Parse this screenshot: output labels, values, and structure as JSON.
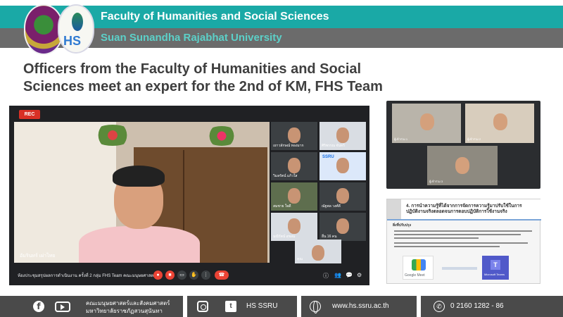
{
  "header": {
    "faculty": "Faculty of Humanities and Social Sciences",
    "university": "Suan Sunandha Rajabhat University",
    "logo_text": "HS"
  },
  "article": {
    "title_line1": "Officers from the Faculty of Humanities and Social",
    "title_line2": "Sciences meet an expert for the 2nd of KM, FHS Team"
  },
  "meeting": {
    "rec_label": "REC",
    "main_speaker": "อัมรินทร์ เผ่าไทย",
    "meeting_name": "ห้องประชุมสรุปผลการดำเนินงาน ครั้งที่ 2 กลุ่ม FHS Team คณะมนุษยศาสตร์...",
    "tiles": [
      {
        "name": "เยาวลักษณ์ ทองมาก"
      },
      {
        "name": "ศิริพรรณ จันทร์"
      },
      {
        "name": "วิมลรัตน์ แก้วใส"
      },
      {
        "name": "SSRU"
      },
      {
        "name": "สมชาย ใจดี"
      },
      {
        "name": "ณัฐพล วงศ์ดี"
      },
      {
        "name": "มณีรัตน์ สุขสม"
      },
      {
        "name": "อื่น 16 คน"
      },
      {
        "name": "คุณ"
      }
    ],
    "end_call_icon": "phone-end-icon"
  },
  "side_meeting": {
    "tiles": [
      {
        "name": "ผู้เข้าร่วม 1"
      },
      {
        "name": "ผู้เข้าร่วม 2"
      },
      {
        "name": "ผู้เข้าร่วม 3"
      }
    ]
  },
  "slide": {
    "heading": "4. การนำความรู้ที่ได้จากการจัดการความรู้มาปรับใช้ในการปฏิบัติงานจริงตลอดจนการตอบปฏิบัติการใช้งานจริง",
    "subheading": "สิ่งที่ปรับปรุง",
    "google_meet_label": "Google Meet",
    "teams_label": "Microsoft Teams",
    "teams_letter": "T"
  },
  "footer": {
    "org_line1": "คณะมนุษยศาสตร์และสังคมศาสตร์",
    "org_line2": "มหาวิทยาลัยราชภัฏสวนสุนันทา",
    "social_handle": "HS SSRU",
    "website": "www.hs.ssru.ac.th",
    "phone": "0 2160 1282 - 86",
    "fb_letter": "f",
    "tw_letter": "t"
  }
}
